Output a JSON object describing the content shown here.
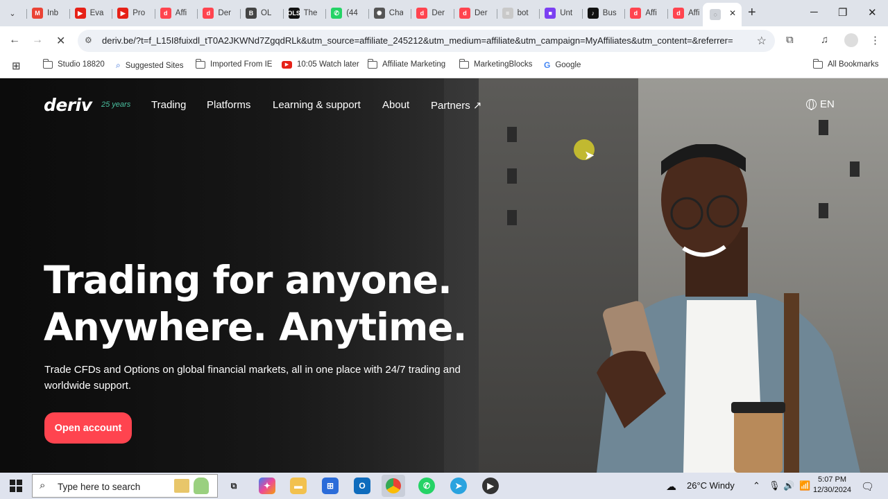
{
  "browser": {
    "tabs": [
      {
        "label": "Inb",
        "icon": "gmail-icon",
        "color": "#ea4335",
        "glyph": "M"
      },
      {
        "label": "Eva",
        "icon": "youtube-icon",
        "color": "#e62117",
        "glyph": "▶"
      },
      {
        "label": "Pro",
        "icon": "youtube-icon",
        "color": "#e62117",
        "glyph": "▶"
      },
      {
        "label": "Affi",
        "icon": "deriv-icon",
        "color": "#ff444f",
        "glyph": "d"
      },
      {
        "label": "Der",
        "icon": "deriv-icon",
        "color": "#ff444f",
        "glyph": "d"
      },
      {
        "label": "OL",
        "icon": "b-logo-icon",
        "color": "#444444",
        "glyph": "B"
      },
      {
        "label": "The",
        "icon": "ols-icon",
        "color": "#111111",
        "glyph": "OLS"
      },
      {
        "label": "(44",
        "icon": "whatsapp-icon",
        "color": "#25d366",
        "glyph": "✆"
      },
      {
        "label": "Cha",
        "icon": "chatgpt-icon",
        "color": "#555555",
        "glyph": "✺"
      },
      {
        "label": "Der",
        "icon": "deriv-icon",
        "color": "#ff444f",
        "glyph": "d"
      },
      {
        "label": "Der",
        "icon": "deriv-icon",
        "color": "#ff444f",
        "glyph": "d"
      },
      {
        "label": "bot",
        "icon": "doc-icon",
        "color": "#c9c9c9",
        "glyph": "≡"
      },
      {
        "label": "Unt",
        "icon": "video-icon",
        "color": "#7b3ff2",
        "glyph": "■"
      },
      {
        "label": "Bus",
        "icon": "tiktok-icon",
        "color": "#111111",
        "glyph": "♪"
      },
      {
        "label": "Affi",
        "icon": "deriv-icon",
        "color": "#ff444f",
        "glyph": "d"
      },
      {
        "label": "Affi",
        "icon": "deriv-icon",
        "color": "#ff444f",
        "glyph": "d"
      }
    ],
    "url": "deriv.be/?t=f_L15I8fuixdl_tT0A2JKWNd7ZgqdRLk&utm_source=affiliate_245212&utm_medium=affiliate&utm_campaign=MyAffiliates&utm_content=&referrer=",
    "bookmarks": [
      {
        "label": "Studio 18820",
        "icon": "folder-icon"
      },
      {
        "label": "Suggested Sites",
        "icon": "search-icon"
      },
      {
        "label": "Imported From IE",
        "icon": "folder-icon"
      },
      {
        "label": "10:05 Watch later",
        "icon": "youtube-icon"
      },
      {
        "label": "Affiliate Marketing",
        "icon": "folder-icon"
      },
      {
        "label": "MarketingBlocks",
        "icon": "folder-icon"
      },
      {
        "label": "Google",
        "icon": "google-icon"
      }
    ],
    "all_bookmarks": "All Bookmarks"
  },
  "page": {
    "logo": "deriv",
    "years": "25 years",
    "nav": [
      "Trading",
      "Platforms",
      "Learning & support",
      "About",
      "Partners ↗"
    ],
    "language": "EN",
    "headline_1": "Trading for anyone.",
    "headline_2": "Anywhere. Anytime.",
    "subtext": "Trade CFDs and Options on global financial markets, all in one place with 24/7 trading and worldwide support.",
    "cta": "Open account"
  },
  "taskbar": {
    "search_placeholder": "Type here to search",
    "weather": "26°C  Windy",
    "time": "5:07 PM",
    "date": "12/30/2024"
  },
  "colors": {
    "accent": "#ff444f",
    "years": "#4ac0a0"
  }
}
